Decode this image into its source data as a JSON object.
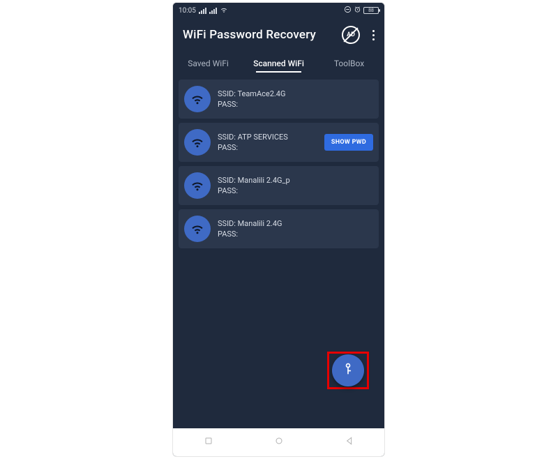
{
  "status": {
    "time": "10:05",
    "battery": "88"
  },
  "app": {
    "title": "WiFi Password Recovery",
    "ad_label": "AD"
  },
  "tabs": {
    "saved": "Saved WiFi",
    "scanned": "Scanned WiFi",
    "toolbox": "ToolBox"
  },
  "labels": {
    "ssid_prefix": "SSID:  ",
    "pass_prefix": "PASS:",
    "show_pwd": "SHOW PWD"
  },
  "networks": [
    {
      "ssid": "TeamAce2.4G",
      "pass": "",
      "show_button": false
    },
    {
      "ssid": "ATP SERVICES",
      "pass": "",
      "show_button": true
    },
    {
      "ssid": "Manalili 2.4G_p",
      "pass": "",
      "show_button": false
    },
    {
      "ssid": "Manalili 2.4G",
      "pass": "",
      "show_button": false
    }
  ]
}
